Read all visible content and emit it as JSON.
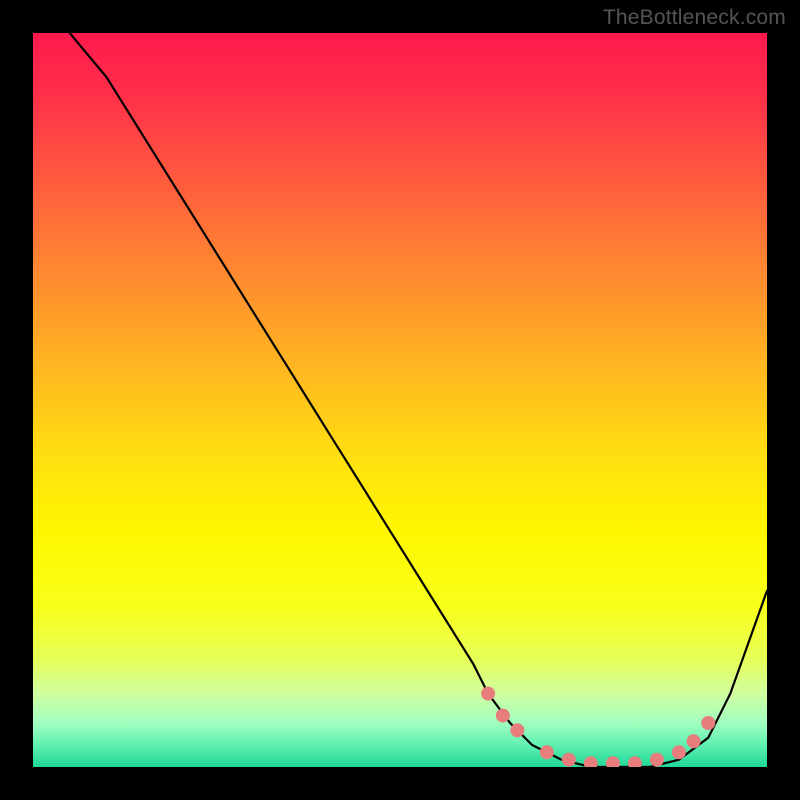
{
  "watermark": "TheBottleneck.com",
  "chart_data": {
    "type": "line",
    "title": "",
    "xlabel": "",
    "ylabel": "",
    "xlim": [
      0,
      100
    ],
    "ylim": [
      0,
      100
    ],
    "grid": false,
    "legend": false,
    "series": [
      {
        "name": "bottleneck-curve",
        "x": [
          5,
          10,
          15,
          20,
          25,
          30,
          35,
          40,
          45,
          50,
          55,
          60,
          62,
          65,
          68,
          72,
          76,
          80,
          84,
          88,
          92,
          95,
          100
        ],
        "y": [
          100,
          94,
          86,
          78,
          70,
          62,
          54,
          46,
          38,
          30,
          22,
          14,
          10,
          6,
          3,
          1,
          0,
          0,
          0,
          1,
          4,
          10,
          24
        ]
      }
    ],
    "markers": {
      "name": "highlight-dots",
      "points": [
        {
          "x": 62,
          "y": 10
        },
        {
          "x": 64,
          "y": 7
        },
        {
          "x": 66,
          "y": 5
        },
        {
          "x": 70,
          "y": 2
        },
        {
          "x": 73,
          "y": 1
        },
        {
          "x": 76,
          "y": 0.5
        },
        {
          "x": 79,
          "y": 0.5
        },
        {
          "x": 82,
          "y": 0.5
        },
        {
          "x": 85,
          "y": 1
        },
        {
          "x": 88,
          "y": 2
        },
        {
          "x": 90,
          "y": 3.5
        },
        {
          "x": 92,
          "y": 6
        }
      ]
    },
    "background_gradient": {
      "top": "#ff1a4d",
      "mid": "#fff700",
      "bottom": "#20d898"
    }
  }
}
